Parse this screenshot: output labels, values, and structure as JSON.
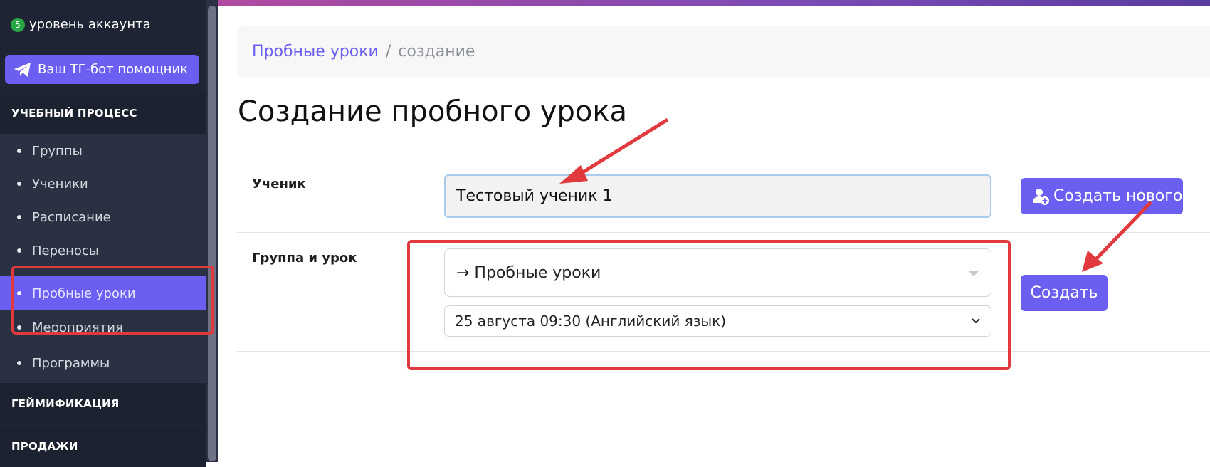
{
  "sidebar": {
    "level_number": "5",
    "level_text": "уровень аккаунта",
    "tg_button": "Ваш ТГ-бот помощник",
    "sections": {
      "learning": "УЧЕБНЫЙ ПРОЦЕСС",
      "gamification": "ГЕЙМИФИКАЦИЯ",
      "sales": "ПРОДАЖИ"
    },
    "items": [
      {
        "label": "Группы"
      },
      {
        "label": "Ученики"
      },
      {
        "label": "Расписание"
      },
      {
        "label": "Переносы"
      },
      {
        "label": "Пробные уроки"
      },
      {
        "label": "Мероприятия"
      },
      {
        "label": "Программы"
      }
    ],
    "active_item": "Пробные уроки"
  },
  "breadcrumb": {
    "parent": "Пробные уроки",
    "separator": "/",
    "current": "создание"
  },
  "page": {
    "title": "Создание пробного урока"
  },
  "form": {
    "student_label": "Ученик",
    "student_value": "Тестовый ученик 1",
    "create_new_label": "Создать нового",
    "group_label": "Группа и урок",
    "group_select_value": "→ Пробные уроки",
    "lesson_select_value": "25 августа 09:30 (Английский язык)",
    "create_label": "Создать"
  },
  "colors": {
    "accent": "#6a5ff0",
    "sidebar_bg": "#1f2535",
    "annotation_red": "#e0393e",
    "badge_green": "#28a745"
  }
}
